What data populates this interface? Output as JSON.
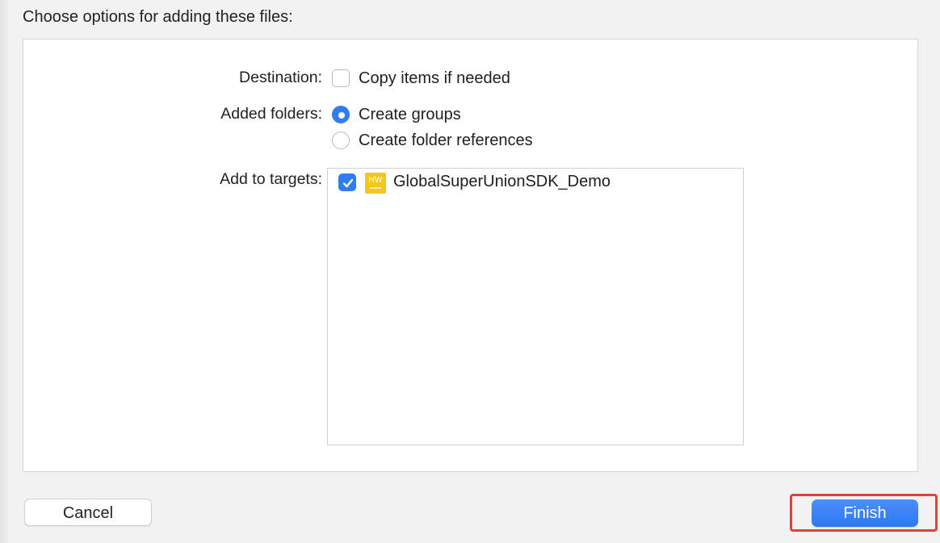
{
  "dialog": {
    "heading": "Choose options for adding these files:"
  },
  "destination": {
    "label": "Destination:",
    "copy_items": {
      "label": "Copy items if needed",
      "checked": false
    }
  },
  "added_folders": {
    "label": "Added folders:",
    "options": [
      {
        "label": "Create groups",
        "selected": true
      },
      {
        "label": "Create folder references",
        "selected": false
      }
    ]
  },
  "targets": {
    "label": "Add to targets:",
    "items": [
      {
        "name": "GlobalSuperUnionSDK_Demo",
        "checked": true,
        "icon": "app-target-icon",
        "icon_text": "HW",
        "icon_color": "#f3c71c"
      }
    ]
  },
  "buttons": {
    "cancel": "Cancel",
    "finish": "Finish"
  },
  "colors": {
    "accent": "#2f7cf6",
    "highlight": "#e0413c"
  }
}
